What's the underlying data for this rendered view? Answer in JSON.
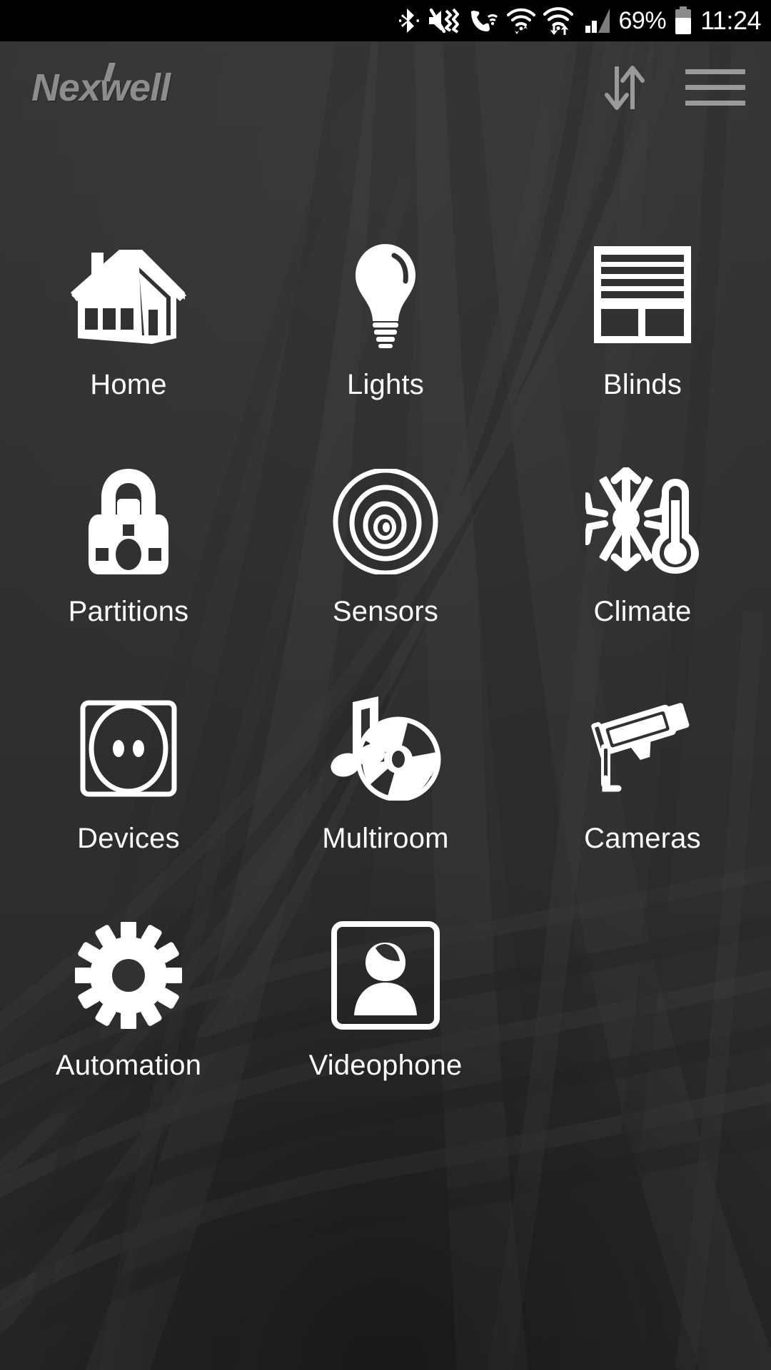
{
  "status_bar": {
    "icons": [
      "bluetooth-icon",
      "vibrate-mute-icon",
      "call-icon",
      "wifi-calling-icon",
      "wifi-data-icon",
      "cellular-signal-icon"
    ],
    "battery_percent": "69%",
    "battery_icon": "battery-icon",
    "clock": "11:24"
  },
  "header": {
    "logo": "Nexwell",
    "sync_icon": "sync-arrows-icon",
    "menu_icon": "hamburger-menu-icon"
  },
  "grid": {
    "items": [
      {
        "label": "Home",
        "icon": "house-icon"
      },
      {
        "label": "Lights",
        "icon": "lightbulb-icon"
      },
      {
        "label": "Blinds",
        "icon": "window-blinds-icon"
      },
      {
        "label": "Partitions",
        "icon": "padlock-icon"
      },
      {
        "label": "Sensors",
        "icon": "motion-sensor-icon"
      },
      {
        "label": "Climate",
        "icon": "snowflake-thermometer-icon"
      },
      {
        "label": "Devices",
        "icon": "power-socket-icon"
      },
      {
        "label": "Multiroom",
        "icon": "music-note-disc-icon"
      },
      {
        "label": "Cameras",
        "icon": "security-camera-icon"
      },
      {
        "label": "Automation",
        "icon": "gear-icon"
      },
      {
        "label": "Videophone",
        "icon": "person-frame-icon"
      }
    ]
  },
  "colors": {
    "status_bar_bg": "#000000",
    "app_bg": "#313131",
    "logo": "#8d8d8d",
    "header_icon": "#9a9a9a",
    "icon_white": "#ffffff",
    "label_text": "#fdfdfd"
  }
}
